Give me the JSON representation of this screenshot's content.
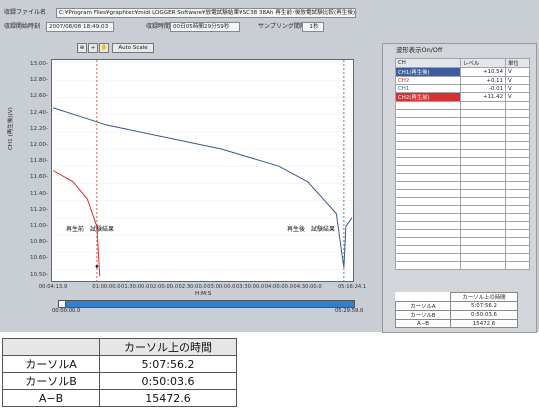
{
  "header": {
    "file_label": "収録ファイル名",
    "file_path": "C:¥Program Files¥graphtec¥midi LOGGER Software¥放電試験結果¥SC38 38Ah 再生前･後放電試験比較(再生後).gbd",
    "start_label": "収録開始時刻",
    "start_value": "2007/08/08 18:49:03",
    "duration_label": "収録時間",
    "duration_value": "00日05時間29分59秒",
    "interval_label": "サンプリング間隔",
    "interval_value": "1秒"
  },
  "toolbar": {
    "zoom_label": "⊕",
    "plus_label": "+",
    "hand_label": "✋",
    "autoscale_label": "Auto Scale"
  },
  "axis": {
    "ylabel": "CH1 (再生後)(V)",
    "xlabel": "H:M:S",
    "y_ticks": [
      "13.00-",
      "12.80-",
      "12.60-",
      "12.40-",
      "12.20-",
      "12.00-",
      "11.80-",
      "11.60-",
      "11.40-",
      "11.20-",
      "11.00-",
      "10.80-",
      "10.60-",
      "10.50-"
    ],
    "x_ticks": [
      "00:04:13.9",
      "01:00:00.0",
      "01:30:00.0",
      "02:00:00.0",
      "02:30:00.0",
      "03:00:00.0",
      "03:30:00.0",
      "04:00:00.0",
      "04:30:00.0",
      "05:16:24.1"
    ],
    "scroll_left": "00:00:00.0",
    "scroll_right": "05:29:59.0"
  },
  "annotations": {
    "before_label": "再生前　試験結果",
    "after_label": "再生後　試験結果"
  },
  "waveform_panel": {
    "title": "波形表示On/Off",
    "col_ch": "CH",
    "col_level": "レベル",
    "col_unit": "単位",
    "rows": [
      {
        "ch": "CH1(再生後)",
        "level": "+10.54",
        "unit": "V"
      },
      {
        "ch": "CH2",
        "level": "+0.11",
        "unit": "V"
      },
      {
        "ch": "CH1",
        "level": "-0.01",
        "unit": "V"
      },
      {
        "ch": "CH2(再生前)",
        "level": "+11.42",
        "unit": "V"
      }
    ]
  },
  "cursor_small": {
    "header": "カーソル上の時間",
    "rows": [
      {
        "label": "カーソルA",
        "value": "5:07:56.2"
      },
      {
        "label": "カーソルB",
        "value": "0:50:03.6"
      },
      {
        "label": "A−B",
        "value": "15472.6"
      }
    ]
  },
  "cursor_big": {
    "header": "カーソル上の時間",
    "rows": [
      {
        "label": "カーソルA",
        "value": "5:07:56.2"
      },
      {
        "label": "カーソルB",
        "value": "0:50:03.6"
      },
      {
        "label": "A−B",
        "value": "15472.6"
      }
    ]
  },
  "chart_data": {
    "type": "line",
    "ylim": [
      10.5,
      13.0
    ],
    "series": [
      {
        "name": "CH1(再生後)",
        "color": "#3a5a8c",
        "x": [
          "00:04:13.9",
          "01:00:00.0",
          "02:00:00.0",
          "03:00:00.0",
          "04:00:00.0",
          "04:30:00.0",
          "05:00:00.0",
          "05:07:56.2",
          "05:10:00.0",
          "05:16:24.1"
        ],
        "y": [
          12.48,
          12.28,
          12.14,
          12.0,
          11.8,
          11.62,
          11.25,
          10.62,
          11.1,
          11.2
        ]
      },
      {
        "name": "CH2(再生前)",
        "color": "#d83030",
        "x": [
          "00:04:13.9",
          "00:25:00.0",
          "00:40:00.0",
          "00:50:03.6",
          "00:53:00.0"
        ],
        "y": [
          11.75,
          11.62,
          11.42,
          11.1,
          10.52
        ]
      }
    ],
    "cursors": [
      "0:50:03.6",
      "5:07:56.2"
    ]
  }
}
